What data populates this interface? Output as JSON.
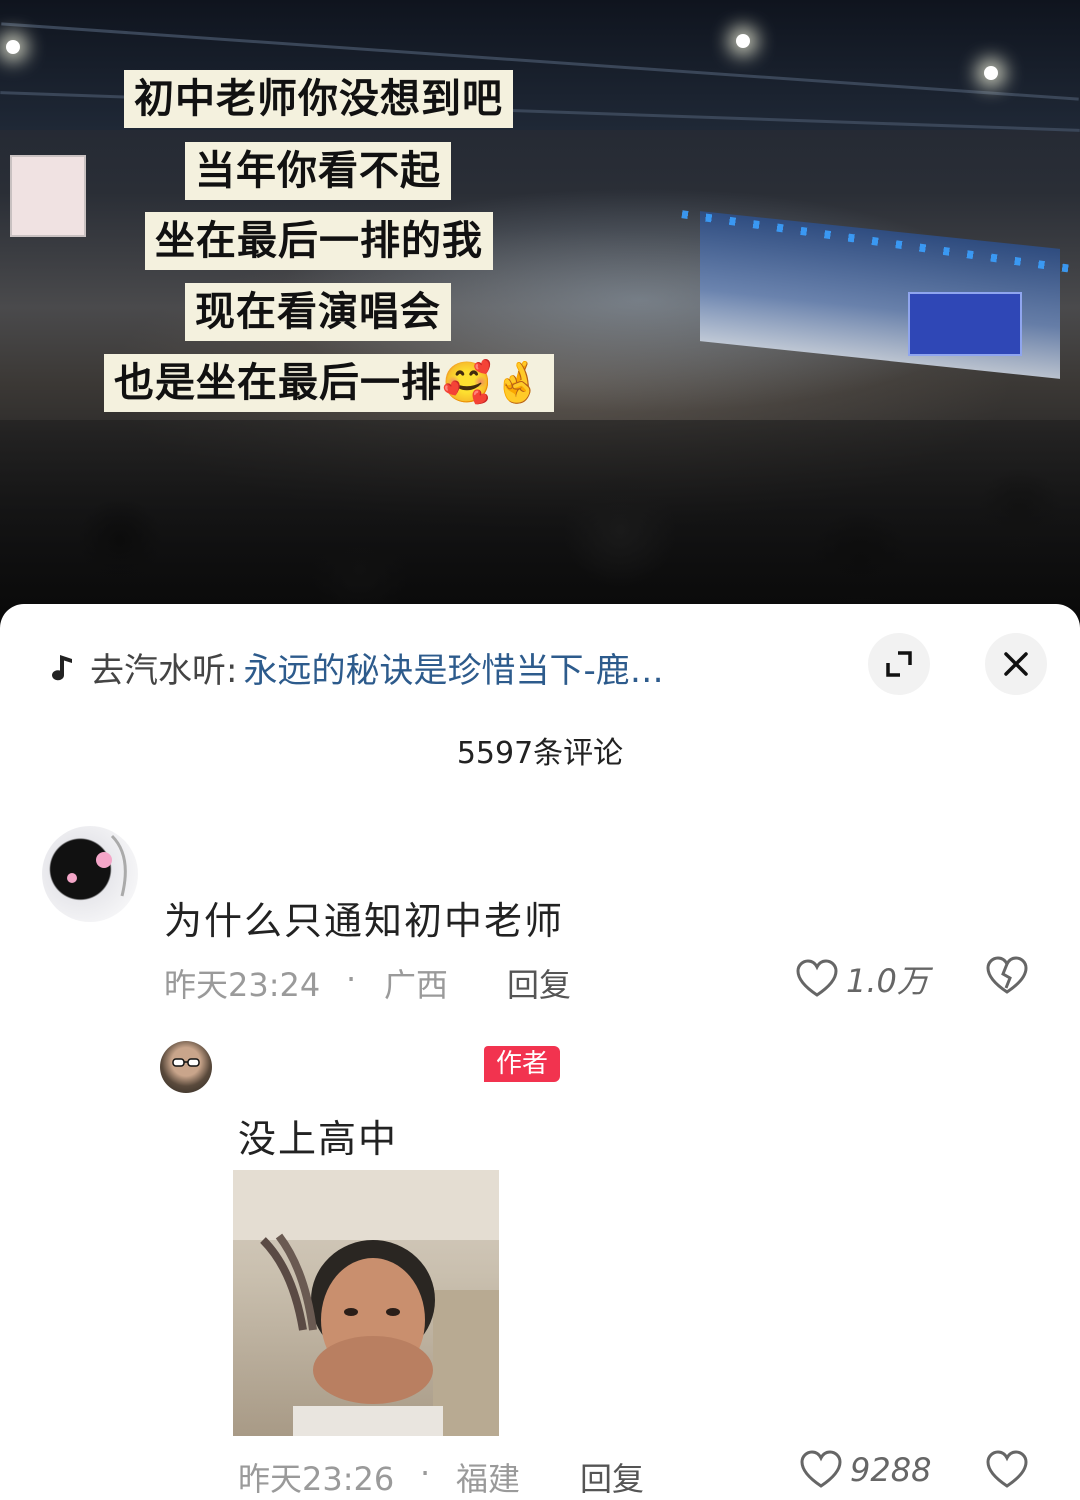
{
  "hero": {
    "caption_lines": [
      "初中老师你没想到吧",
      "当年你看不起",
      "坐在最后一排的我",
      "现在看演唱会",
      "也是坐在最后一排🥰🤞"
    ]
  },
  "sheet": {
    "music_prefix": "去汽水听:",
    "music_title": "永远的秘诀是珍惜当下-鹿…",
    "comment_count": "5597条评论",
    "comment": {
      "text": "为什么只通知初中老师",
      "time": "昨天23:24",
      "separator": "·",
      "location": "广西",
      "reply_label": "回复",
      "likes": "1.0万"
    },
    "reply": {
      "badge": "作者",
      "text": "没上高中",
      "time": "昨天23:26",
      "separator": "·",
      "location": "福建",
      "reply_label": "回复",
      "likes": "9288"
    }
  }
}
